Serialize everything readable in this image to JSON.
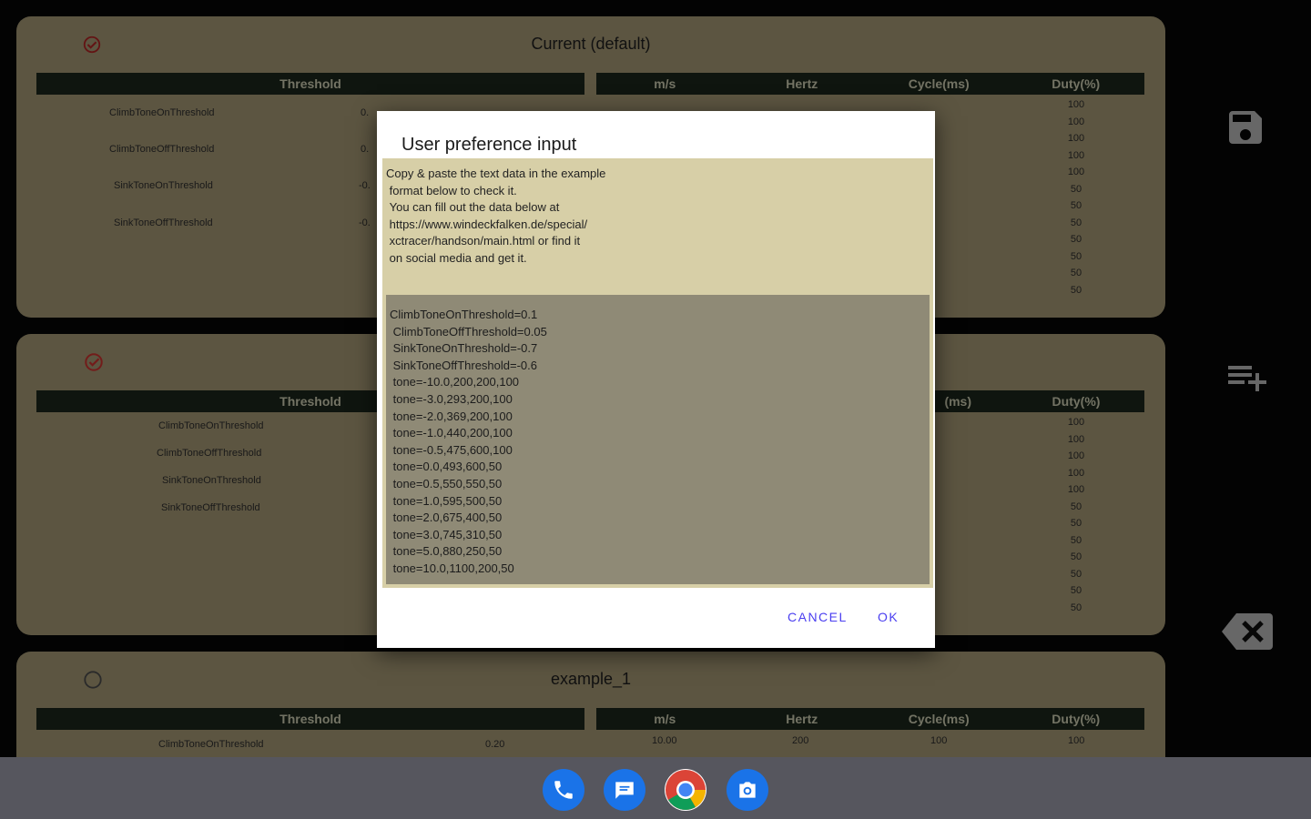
{
  "cards": [
    {
      "title": "Current (default)",
      "threshold_header": "Threshold",
      "tone_headers": [
        "m/s",
        "Hertz",
        "Cycle(ms)",
        "Duty(%)"
      ],
      "labels": [
        "ClimbToneOnThreshold",
        "ClimbToneOffThreshold",
        "SinkToneOnThreshold",
        "SinkToneOffThreshold"
      ],
      "threshold_values": [
        "0.",
        "0.",
        "-0.",
        "-0."
      ],
      "duty": [
        "100",
        "100",
        "100",
        "100",
        "100",
        "50",
        "50",
        "50",
        "50",
        "50",
        "50",
        "50"
      ]
    },
    {
      "title": "",
      "threshold_header": "Threshold",
      "tone_headers": [
        "(ms)",
        "Duty(%)"
      ],
      "labels": [
        "ClimbToneOnThreshold",
        "ClimbToneOffThreshold",
        "SinkToneOnThreshold",
        "SinkToneOffThreshold"
      ],
      "duty": [
        "100",
        "100",
        "100",
        "100",
        "100",
        "50",
        "50",
        "50",
        "50",
        "50",
        "50",
        "50"
      ]
    },
    {
      "title": "example_1",
      "threshold_header": "Threshold",
      "tone_headers": [
        "m/s",
        "Hertz",
        "Cycle(ms)",
        "Duty(%)"
      ],
      "labels": [
        "ClimbToneOnThreshold"
      ],
      "first_row": {
        "threshold": "0.20",
        "ms": "10.00",
        "hertz": "200",
        "cycle": "100",
        "duty": "100"
      }
    }
  ],
  "dialog": {
    "title": "User preference input",
    "info": "Copy & paste the text data in the example\n format below to check it.\n You can fill out the data below at\n https://www.windeckfalken.de/special/\n xctracer/handson/main.html or find it\n on social media and get it.",
    "input_value": "ClimbToneOnThreshold=0.1\n ClimbToneOffThreshold=0.05\n SinkToneOnThreshold=-0.7\n SinkToneOffThreshold=-0.6\n tone=-10.0,200,200,100\n tone=-3.0,293,200,100\n tone=-2.0,369,200,100\n tone=-1.0,440,200,100\n tone=-0.5,475,600,100\n tone=0.0,493,600,50\n tone=0.5,550,550,50\n tone=1.0,595,500,50\n tone=2.0,675,400,50\n tone=3.0,745,310,50\n tone=5.0,880,250,50\n tone=10.0,1100,200,50",
    "cancel_label": "CANCEL",
    "ok_label": "OK",
    "accent": "#4a3ef0"
  },
  "side_actions": [
    "save-icon",
    "playlist-add-icon",
    "backspace-icon"
  ],
  "dock": [
    "phone-icon",
    "messages-icon",
    "chrome-icon",
    "camera-icon"
  ]
}
